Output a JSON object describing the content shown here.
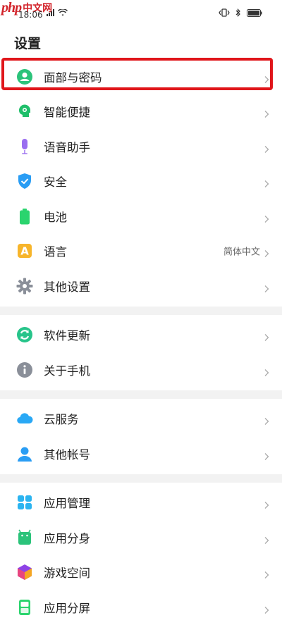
{
  "watermark": {
    "logo": "php",
    "text": "中文网"
  },
  "status": {
    "time": "18:06"
  },
  "title": "设置",
  "groups": [
    [
      {
        "id": "face",
        "label": "面部与密码",
        "value": "",
        "icon": "person-icon",
        "color": "#2bc37a"
      },
      {
        "id": "smart",
        "label": "智能便捷",
        "value": "",
        "icon": "smart-head-icon",
        "color": "#1fbf6a"
      },
      {
        "id": "voice",
        "label": "语音助手",
        "value": "",
        "icon": "microphone-icon",
        "color": "#9a6ef0"
      },
      {
        "id": "security",
        "label": "安全",
        "value": "",
        "icon": "shield-icon",
        "color": "#2a9df4"
      },
      {
        "id": "battery",
        "label": "电池",
        "value": "",
        "icon": "battery-icon",
        "color": "#2bd46e"
      },
      {
        "id": "language",
        "label": "语言",
        "value": "简体中文",
        "icon": "language-a-icon",
        "color": "#f7b52b"
      },
      {
        "id": "other",
        "label": "其他设置",
        "value": "",
        "icon": "gear-icon",
        "color": "#8a8f99"
      }
    ],
    [
      {
        "id": "update",
        "label": "软件更新",
        "value": "",
        "icon": "refresh-icon",
        "color": "#27c48a"
      },
      {
        "id": "about",
        "label": "关于手机",
        "value": "",
        "icon": "info-icon",
        "color": "#8a8f99"
      }
    ],
    [
      {
        "id": "cloud",
        "label": "云服务",
        "value": "",
        "icon": "cloud-icon",
        "color": "#29a8f5"
      },
      {
        "id": "account",
        "label": "其他帐号",
        "value": "",
        "icon": "account-icon",
        "color": "#2a9df4"
      }
    ],
    [
      {
        "id": "apps",
        "label": "应用管理",
        "value": "",
        "icon": "apps-grid-icon",
        "color": "#2bb4f0"
      },
      {
        "id": "clone",
        "label": "应用分身",
        "value": "",
        "icon": "android-icon",
        "color": "#2bc37a"
      },
      {
        "id": "gamespace",
        "label": "游戏空间",
        "value": "",
        "icon": "cube-icon",
        "color": "#8e43e6"
      },
      {
        "id": "split",
        "label": "应用分屏",
        "value": "",
        "icon": "split-screen-icon",
        "color": "#2bd46e"
      }
    ]
  ]
}
